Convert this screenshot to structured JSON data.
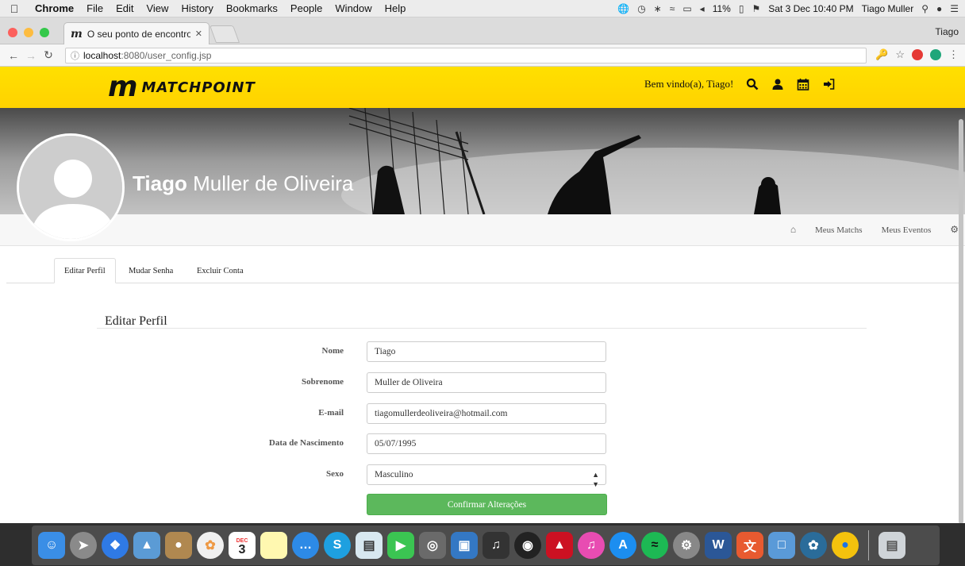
{
  "menubar": {
    "app": "Chrome",
    "items": [
      "File",
      "Edit",
      "View",
      "History",
      "Bookmarks",
      "People",
      "Window",
      "Help"
    ],
    "battery": "11%",
    "datetime": "Sat 3 Dec  10:40 PM",
    "user": "Tiago Muller"
  },
  "browser": {
    "tab_title": "O seu ponto de encontro dos e",
    "profile": "Tiago",
    "url_host": "localhost",
    "url_path": ":8080/user_config.jsp"
  },
  "site": {
    "logo_text": "MATCHPOINT",
    "welcome": "Bem vindo(a), Tiago!",
    "user_first": "Tiago",
    "user_rest": " Muller de Oliveira",
    "subnav": [
      "Meus Matchs",
      "Meus Eventos"
    ],
    "tabs": [
      "Editar Perfil",
      "Mudar Senha",
      "Excluir Conta"
    ]
  },
  "form": {
    "title": "Editar Perfil",
    "fields": [
      {
        "label": "Nome",
        "value": "Tiago"
      },
      {
        "label": "Sobrenome",
        "value": "Muller de Oliveira"
      },
      {
        "label": "E-mail",
        "value": "tiagomullerdeoliveira@hotmail.com"
      },
      {
        "label": "Data de Nascimento",
        "value": "05/07/1995"
      },
      {
        "label": "Sexo",
        "value": "Masculino"
      }
    ],
    "submit": "Confirmar Alterações"
  },
  "dock": {
    "calendar_day": "3",
    "calendar_month": "DEC"
  },
  "colors": {
    "header_yellow": "#ffd800",
    "confirm_green": "#5cb85c"
  }
}
